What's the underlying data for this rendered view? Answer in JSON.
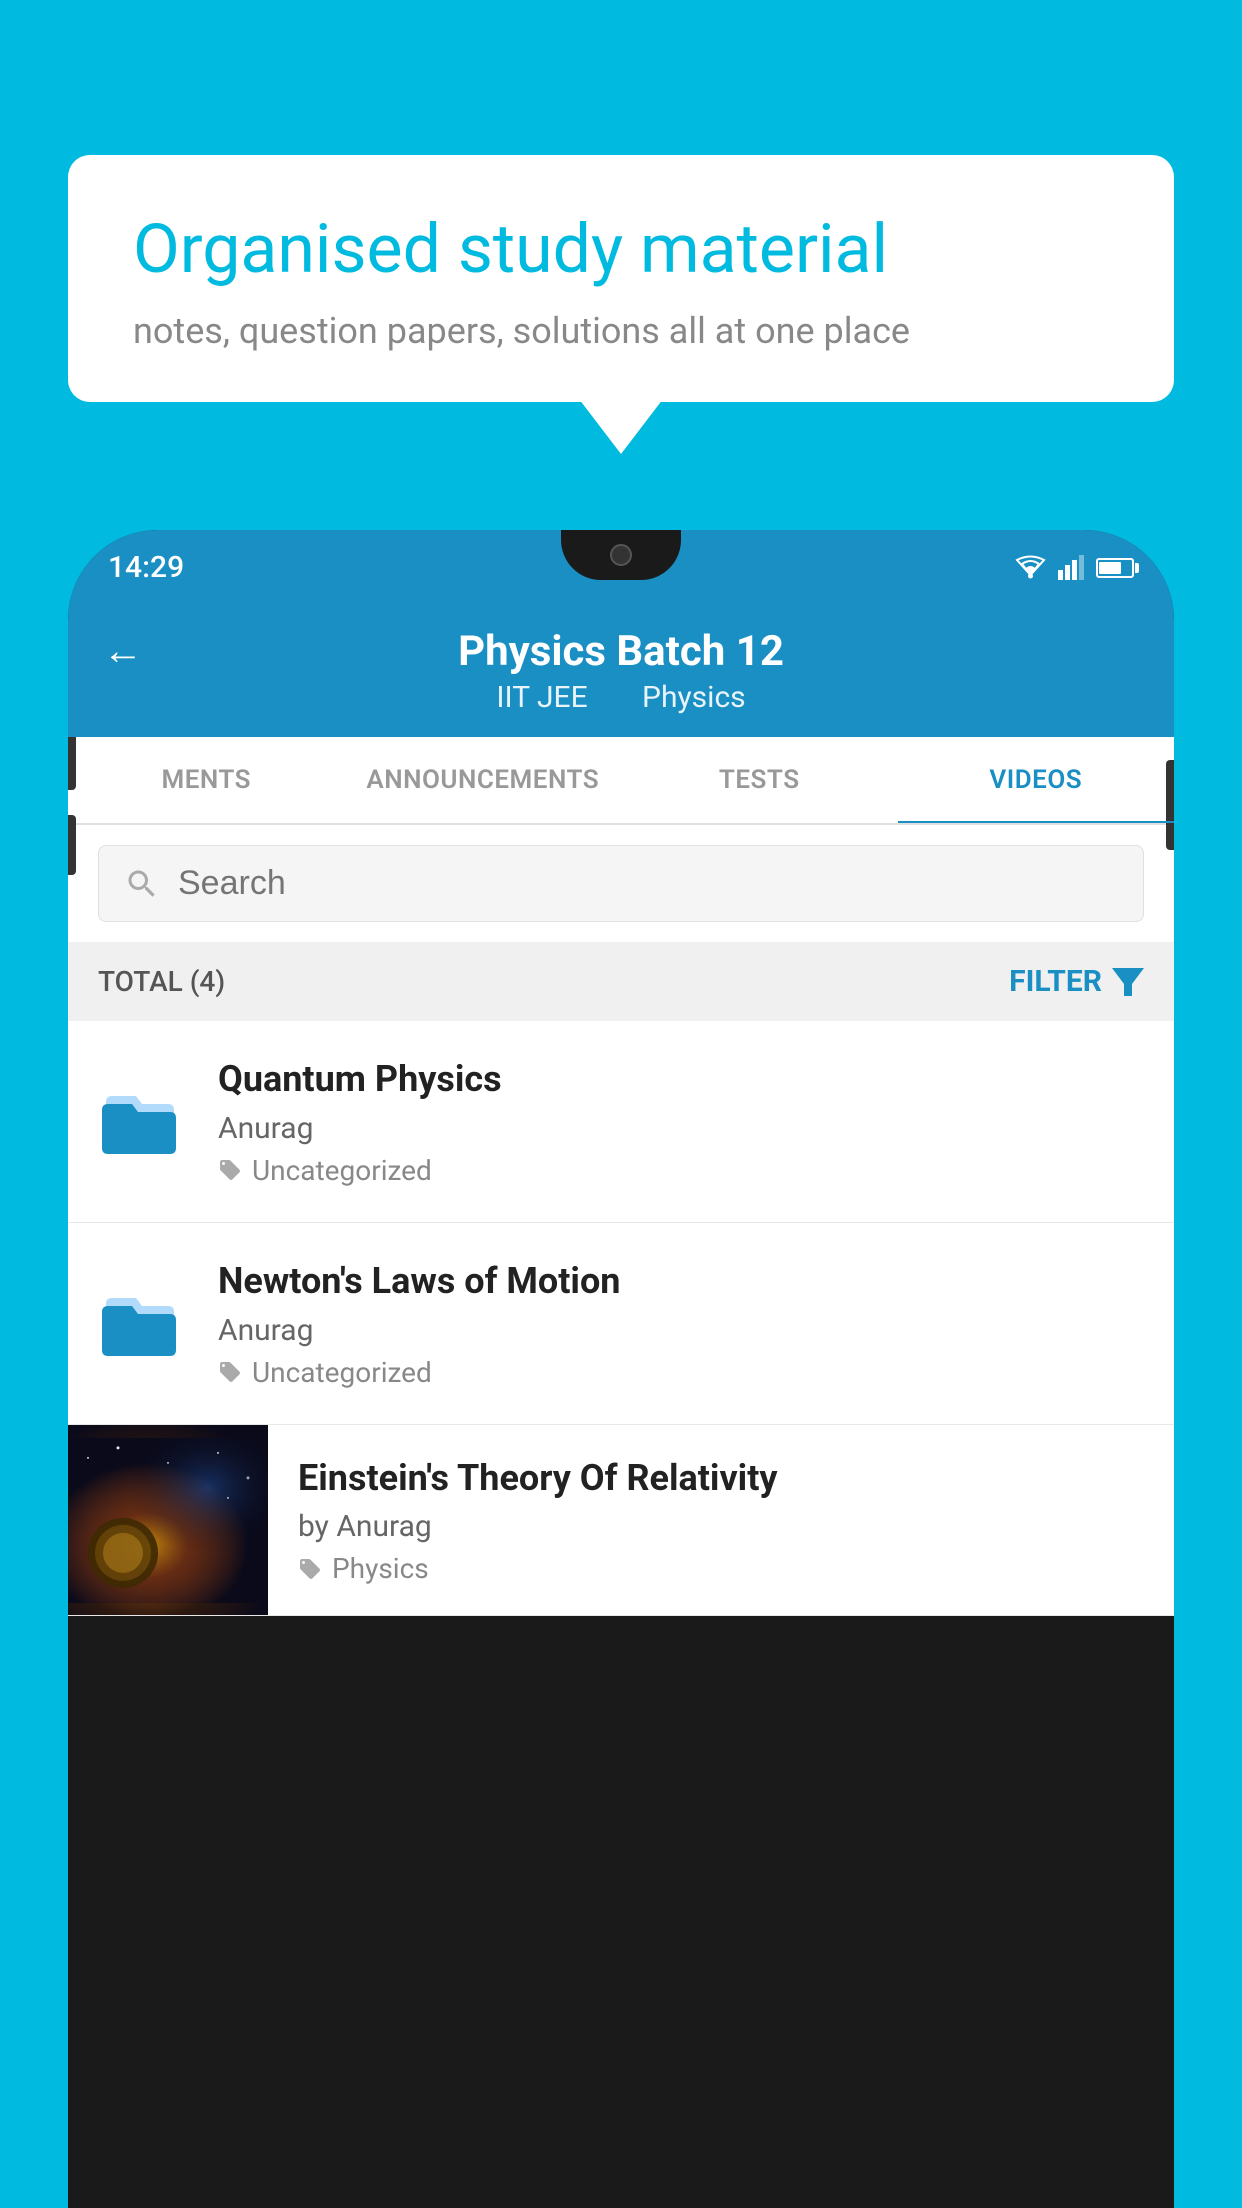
{
  "background_color": "#00BADF",
  "speech_bubble": {
    "heading": "Organised study material",
    "subtext": "notes, question papers, solutions all at one place"
  },
  "phone": {
    "status_bar": {
      "time": "14:29"
    },
    "header": {
      "title": "Physics Batch 12",
      "subtitle_part1": "IIT JEE",
      "subtitle_part2": "Physics",
      "back_label": "←"
    },
    "tabs": [
      {
        "label": "MENTS",
        "active": false
      },
      {
        "label": "ANNOUNCEMENTS",
        "active": false
      },
      {
        "label": "TESTS",
        "active": false
      },
      {
        "label": "VIDEOS",
        "active": true
      }
    ],
    "search": {
      "placeholder": "Search"
    },
    "filter": {
      "total_label": "TOTAL (4)",
      "filter_label": "FILTER"
    },
    "videos": [
      {
        "title": "Quantum Physics",
        "author": "Anurag",
        "tag": "Uncategorized",
        "has_thumbnail": false
      },
      {
        "title": "Newton's Laws of Motion",
        "author": "Anurag",
        "tag": "Uncategorized",
        "has_thumbnail": false
      },
      {
        "title": "Einstein's Theory Of Relativity",
        "author": "by Anurag",
        "tag": "Physics",
        "has_thumbnail": true
      }
    ]
  }
}
